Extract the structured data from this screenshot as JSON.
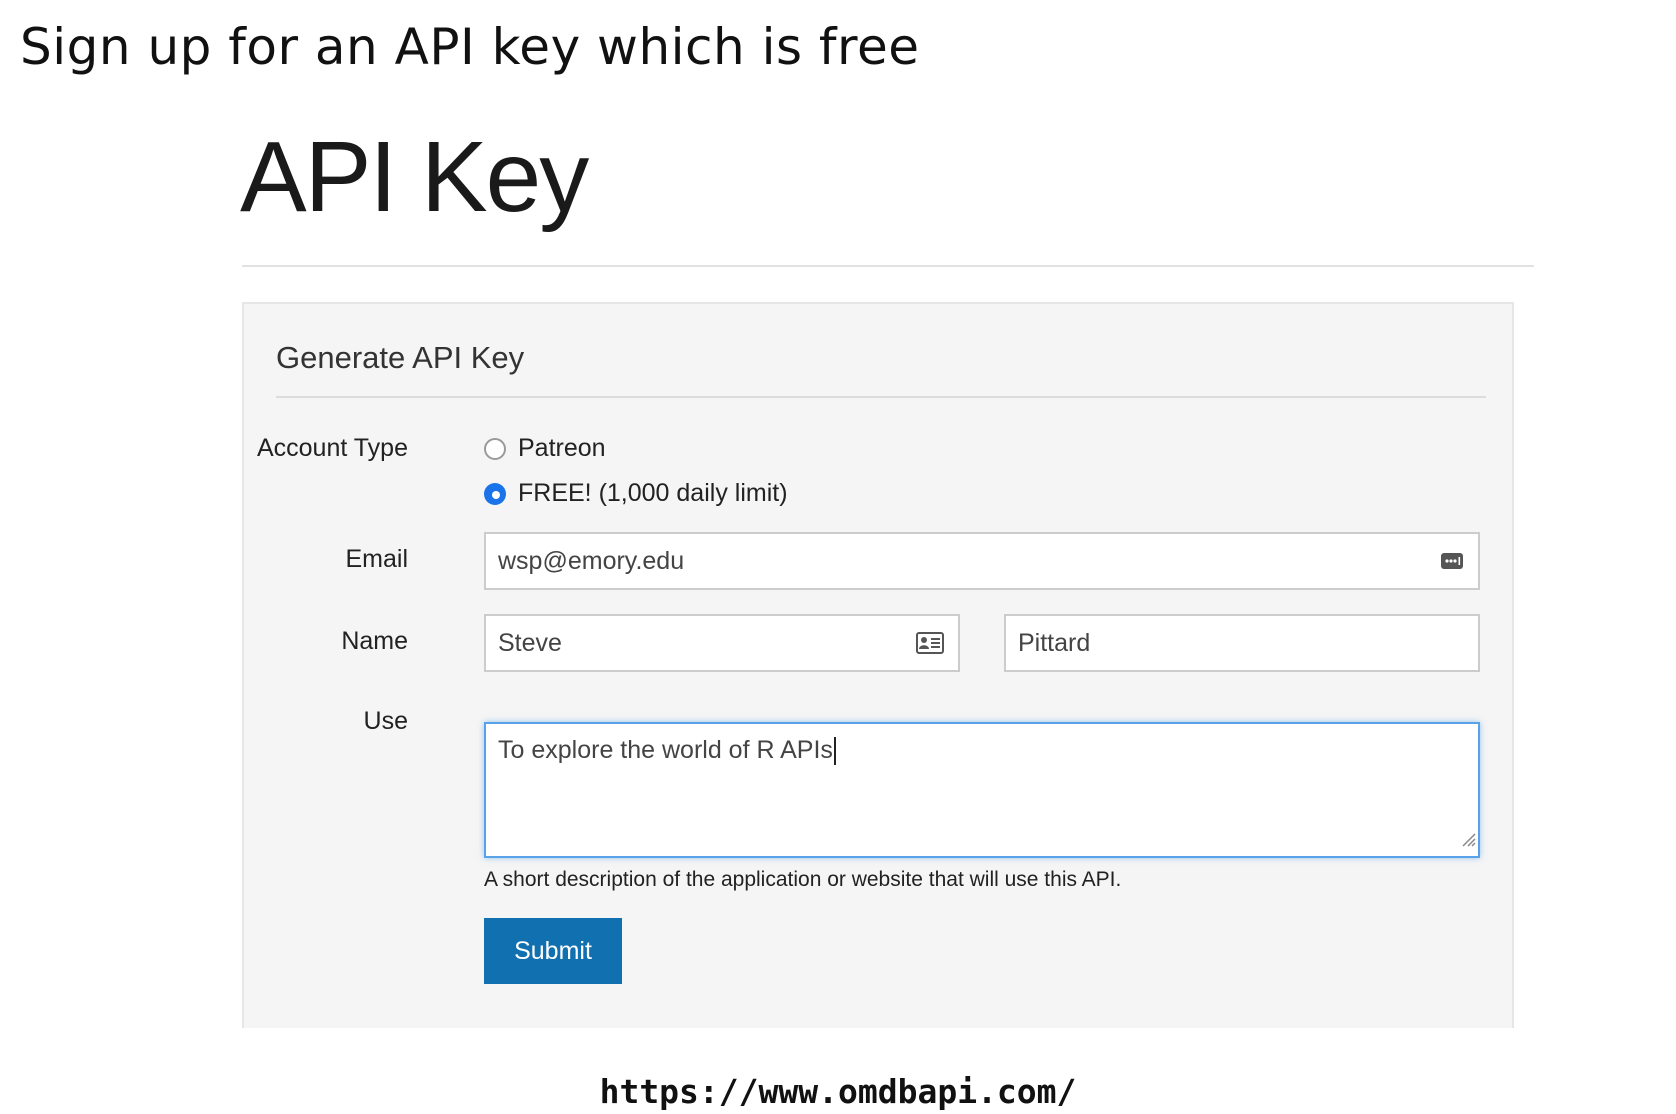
{
  "slide": {
    "title": "Sign up for an API key which is free",
    "url": "https://www.omdbapi.com/"
  },
  "page": {
    "heading": "API Key"
  },
  "form": {
    "panel_title": "Generate API Key",
    "account_type": {
      "label": "Account Type",
      "options": [
        {
          "label": "Patreon",
          "selected": false
        },
        {
          "label": "FREE! (1,000 daily limit)",
          "selected": true
        }
      ]
    },
    "email": {
      "label": "Email",
      "value": "wsp@emory.edu",
      "icon": "autofill-dots-icon"
    },
    "name": {
      "label": "Name",
      "first_value": "Steve",
      "last_value": "Pittard",
      "icon": "contact-card-icon"
    },
    "use": {
      "label": "Use",
      "value": "To explore the world of R APIs",
      "help": "A short description of the application or website that will use this API."
    },
    "submit_label": "Submit"
  },
  "colors": {
    "panel_bg": "#f5f5f5",
    "submit_bg": "#1170b0",
    "radio_selected": "#1a73e8",
    "focus_border": "#5aa2e8"
  }
}
